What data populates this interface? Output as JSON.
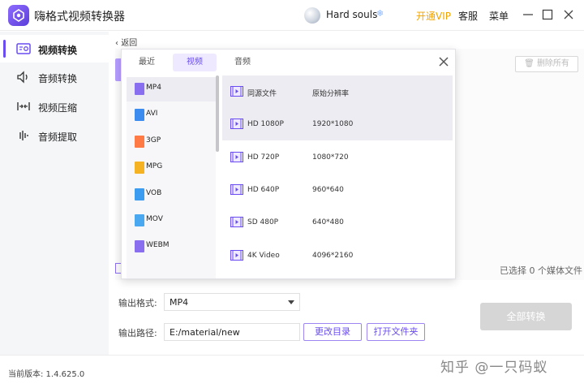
{
  "app": {
    "title": "嗨格式视频转换器"
  },
  "user": {
    "name": "Hard souls",
    "decoration": "❄"
  },
  "header": {
    "vip_label": "开通VIP",
    "service_label": "客服",
    "menu_label": "菜单"
  },
  "sidebar": {
    "items": [
      {
        "label": "视频转换",
        "icon": "video-convert-icon",
        "active": true
      },
      {
        "label": "音频转换",
        "icon": "audio-convert-icon",
        "active": false
      },
      {
        "label": "视频压缩",
        "icon": "video-compress-icon",
        "active": false
      },
      {
        "label": "音频提取",
        "icon": "audio-extract-icon",
        "active": false
      }
    ]
  },
  "main": {
    "back_label": "返回",
    "delete_all_label": "删除所有",
    "selected_count_text": "已选择 0 个媒体文件"
  },
  "format_popup": {
    "tabs": [
      {
        "label": "最近",
        "active": false
      },
      {
        "label": "视频",
        "active": true
      },
      {
        "label": "音频",
        "active": false
      }
    ],
    "formats": [
      {
        "name": "MP4",
        "color": "#8a6ef0",
        "active": true
      },
      {
        "name": "AVI",
        "color": "#3c8cf0"
      },
      {
        "name": "3GP",
        "color": "#ff7a45"
      },
      {
        "name": "MPG",
        "color": "#f5b324"
      },
      {
        "name": "VOB",
        "color": "#3c9cf0"
      },
      {
        "name": "MOV",
        "color": "#4aa8f0"
      },
      {
        "name": "WEBM",
        "color": "#8a6ef0"
      }
    ],
    "resolutions": [
      {
        "name": "同源文件",
        "size": "原始分辨率",
        "active": true
      },
      {
        "name": "HD 1080P",
        "size": "1920*1080",
        "active": true
      },
      {
        "name": "HD 720P",
        "size": "1080*720"
      },
      {
        "name": "HD 640P",
        "size": "960*640"
      },
      {
        "name": "SD 480P",
        "size": "640*480"
      },
      {
        "name": "4K Video",
        "size": "4096*2160"
      }
    ]
  },
  "output": {
    "format_label": "输出格式:",
    "format_value": "MP4",
    "path_label": "输出路径:",
    "path_value": "E:/material/new",
    "change_dir_label": "更改目录",
    "open_folder_label": "打开文件夹",
    "convert_all_label": "全部转换"
  },
  "footer": {
    "version_text": "当前版本: 1.4.625.0",
    "watermark": "知乎 @一只码蚁"
  },
  "colors": {
    "accent": "#6a4cf0",
    "vip": "#f0a400",
    "disabled_button": "#d6d6d6"
  }
}
